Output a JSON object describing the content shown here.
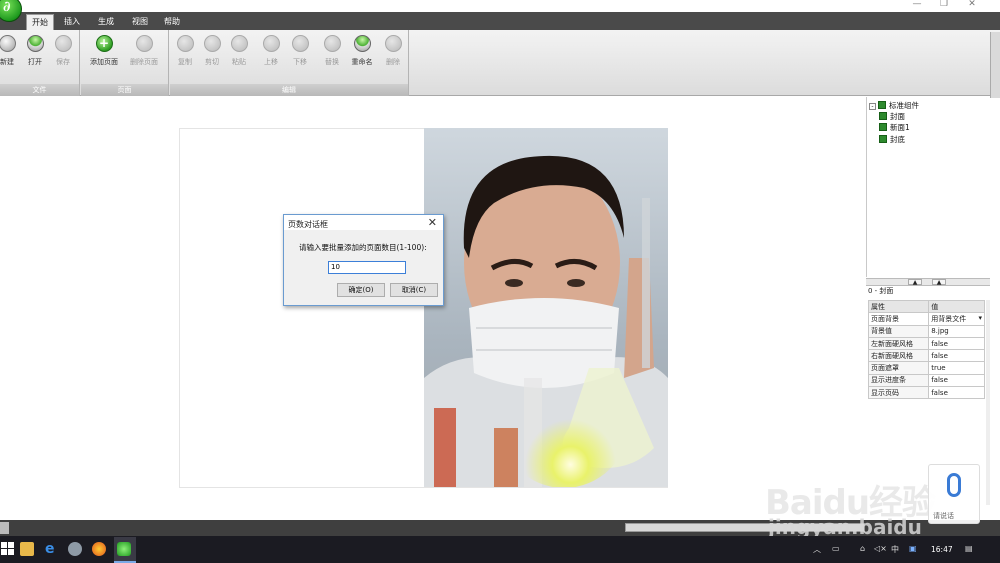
{
  "tabs": [
    {
      "label": "开始",
      "active": true
    },
    {
      "label": "插入",
      "active": false
    },
    {
      "label": "生成",
      "active": false
    },
    {
      "label": "视图",
      "active": false
    },
    {
      "label": "帮助",
      "active": false
    }
  ],
  "ribbon": {
    "groups": [
      {
        "label": "文件",
        "buttons": [
          "新建",
          "打开",
          "保存"
        ]
      },
      {
        "label": "页面",
        "buttons": [
          "添加页面",
          "删除页面"
        ]
      },
      {
        "label": "编辑",
        "buttons": [
          "复制",
          "剪切",
          "粘贴",
          "上移",
          "下移",
          "替换",
          "重命名",
          "删除"
        ]
      }
    ]
  },
  "dialog": {
    "title": "页数对话框",
    "prompt": "请输入要批量添加的页面数目(1-100):",
    "input_value": "10",
    "ok_label": "确定(O)",
    "cancel_label": "取消(C)"
  },
  "tree": {
    "root": "标准组件",
    "items": [
      "封面",
      "新面1",
      "封底"
    ]
  },
  "properties": {
    "caption": "0 - 封面",
    "header": [
      "属性",
      "值"
    ],
    "rows": [
      {
        "name": "页面背景",
        "value": "用背景文件"
      },
      {
        "name": "背景值",
        "value": "8.jpg"
      },
      {
        "name": "左新面硬风格",
        "value": "false"
      },
      {
        "name": "右新面硬风格",
        "value": "false"
      },
      {
        "name": "页面遮罩",
        "value": "true"
      },
      {
        "name": "显示进度条",
        "value": "false"
      },
      {
        "name": "显示页码",
        "value": "false"
      }
    ]
  },
  "taskbar": {
    "tray_lang": "中",
    "clock": "16:47"
  },
  "watermark": {
    "logo": "Baidu经验",
    "url": "jingyan.baidu",
    "voice": "请说话"
  },
  "colors": {
    "tabstrip": "#4a4a4a",
    "ribbon_group_label": "#bcbcbc",
    "accent_green": "#2f9d22",
    "dialog_border": "#6a9bd0"
  }
}
